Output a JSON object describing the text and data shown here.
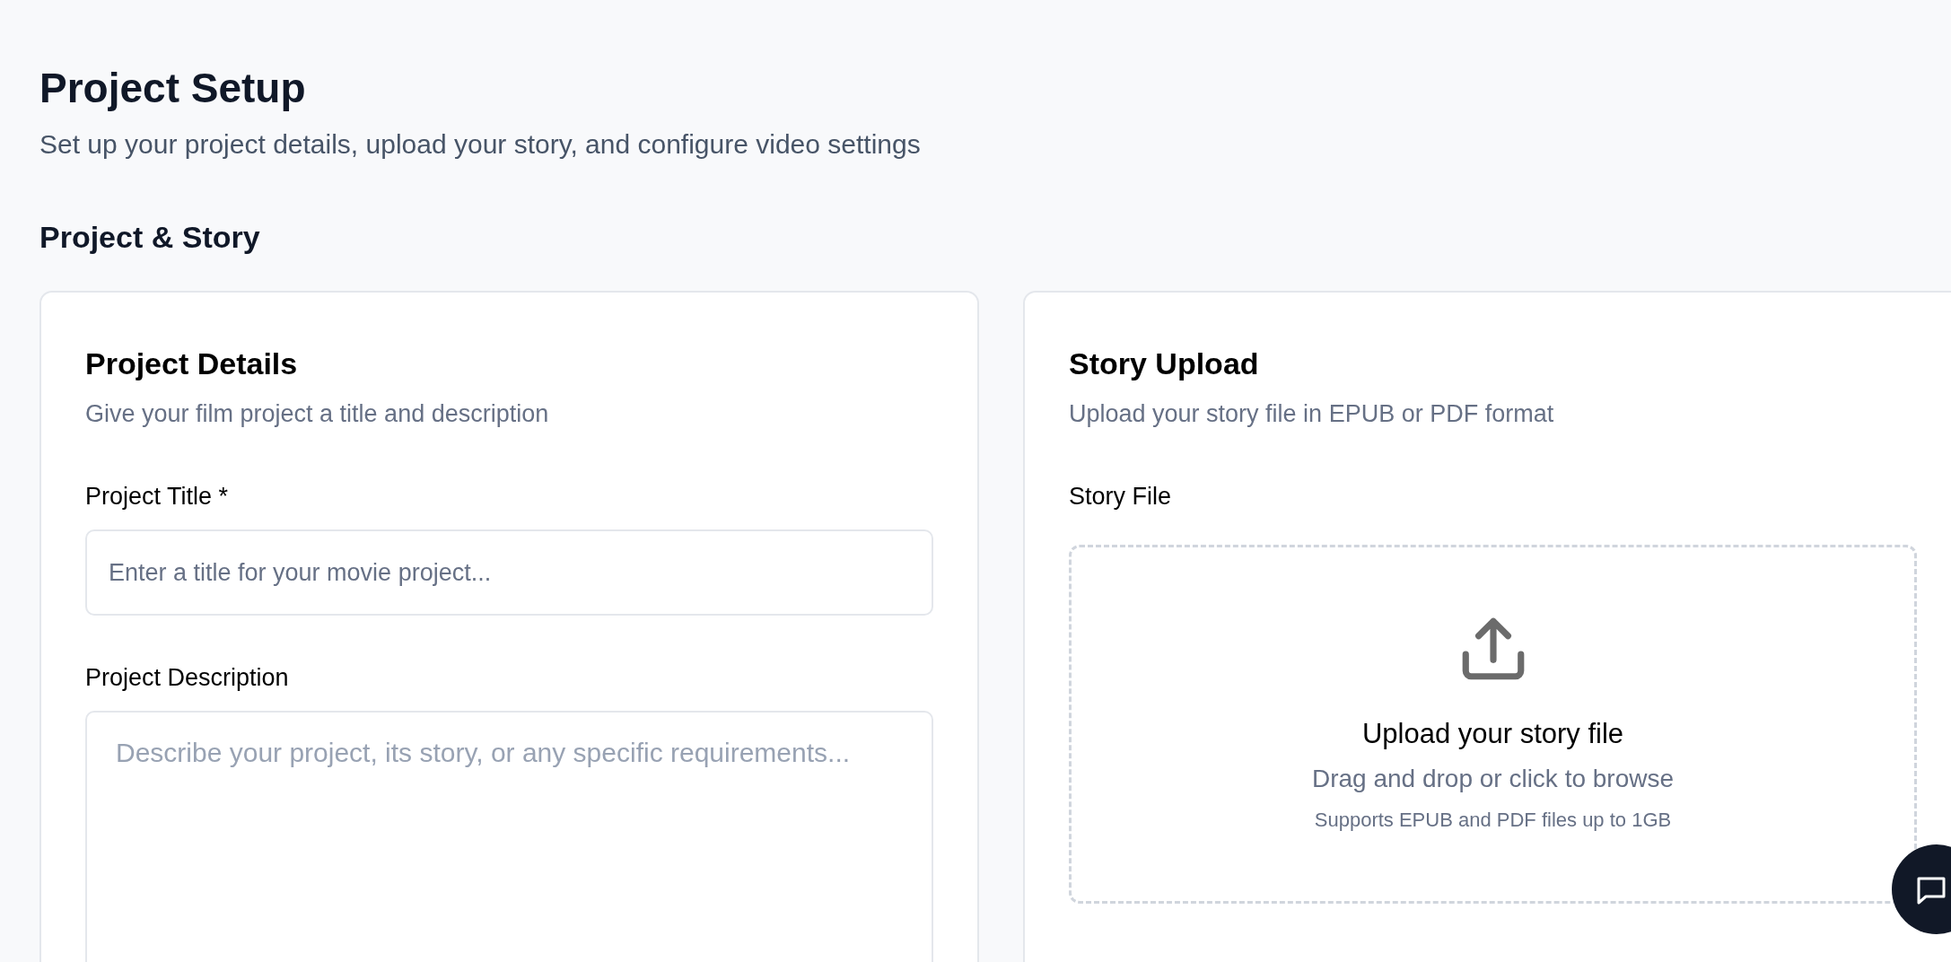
{
  "page": {
    "title": "Project Setup",
    "subtitle": "Set up your project details, upload your story, and configure video settings"
  },
  "section": {
    "title": "Project & Story"
  },
  "cards": [
    {
      "title": "Project Details",
      "description": "Give your film project a title and description",
      "fields": [
        {
          "kind": "input",
          "label": "Project Title *",
          "placeholder": "Enter a title for your movie project..."
        },
        {
          "kind": "textarea",
          "label": "Project Description",
          "placeholder": "Describe your project, its story, or any specific requirements..."
        }
      ]
    },
    {
      "title": "Story Upload",
      "description": "Upload your story file in EPUB or PDF format",
      "fields": [
        {
          "kind": "dropzone",
          "label": "Story File",
          "title": "Upload your story file",
          "hint": "Drag and drop or click to browse",
          "note": "Supports EPUB and PDF files up to 1GB"
        }
      ]
    }
  ]
}
